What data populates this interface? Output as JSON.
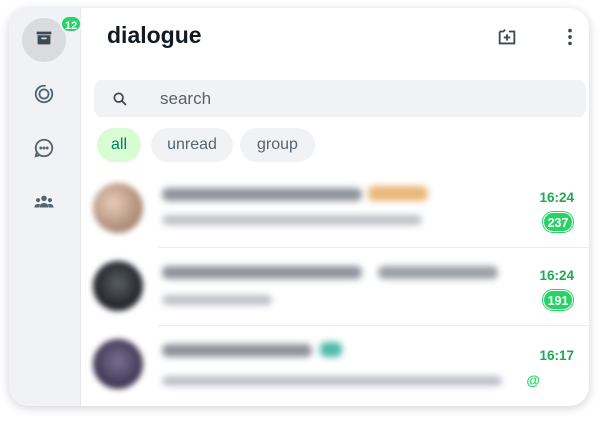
{
  "rail": {
    "chats_badge": "12",
    "icons": [
      "chats-icon",
      "status-icon",
      "channels-icon",
      "communities-icon"
    ]
  },
  "header": {
    "title": "dialogue",
    "new_chat_icon": "new-chat-icon",
    "menu_icon": "more-vertical-icon"
  },
  "search": {
    "placeholder": "search"
  },
  "filters": [
    {
      "label": "all",
      "active": true
    },
    {
      "label": "unread",
      "active": false
    },
    {
      "label": "group",
      "active": false
    }
  ],
  "chats": [
    {
      "time": "16:24",
      "unread": "237",
      "mention": ""
    },
    {
      "time": "16:24",
      "unread": "191",
      "mention": ""
    },
    {
      "time": "16:17",
      "unread": "",
      "mention": "@"
    }
  ],
  "colors": {
    "accent": "#25d366",
    "accent_text": "#1fa855",
    "active_chip_bg": "#d9fdd3",
    "active_chip_text": "#008069",
    "rail_bg": "#f0f2f5"
  }
}
